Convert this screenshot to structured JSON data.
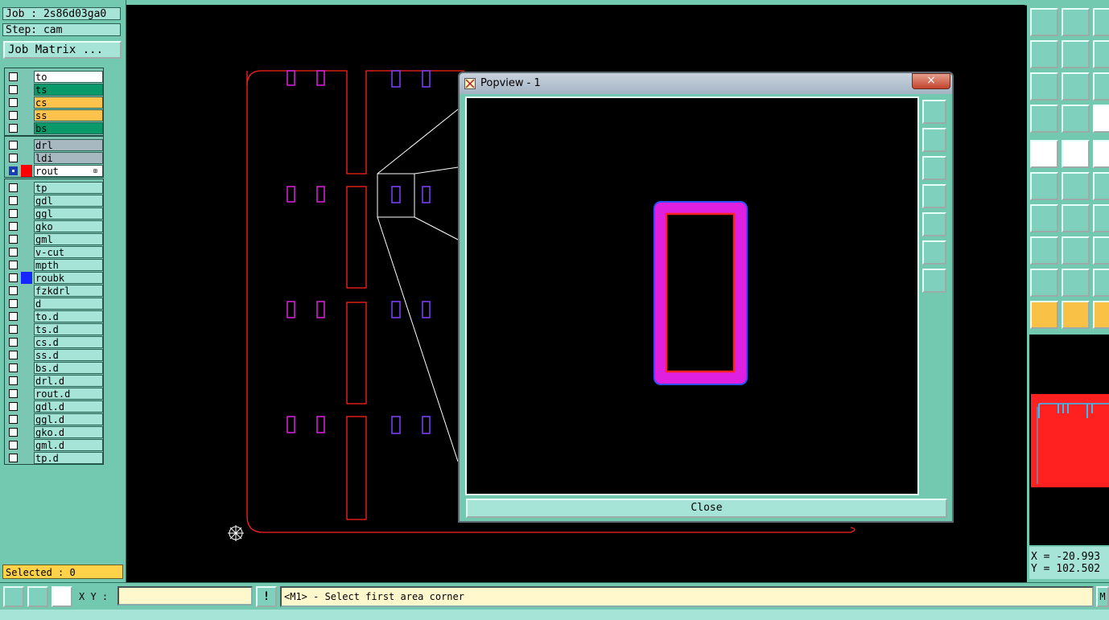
{
  "job": {
    "job_text": "Job : 2s86d03ga0",
    "step_text": "Step: cam",
    "matrix_label": "Job Matrix ..."
  },
  "layers": {
    "group1": [
      {
        "name": "to",
        "bg": "#ffffff"
      },
      {
        "name": "ts",
        "bg": "#0a9a6a"
      },
      {
        "name": "cs",
        "bg": "#ffc34d"
      },
      {
        "name": "ss",
        "bg": "#ffc34d"
      },
      {
        "name": "bs",
        "bg": "#0a9a6a"
      }
    ],
    "group2": [
      {
        "name": "drl",
        "bg": "#a8b8c0"
      },
      {
        "name": "ldi",
        "bg": "#a8b8c0"
      },
      {
        "name": "rout",
        "bg": "#ffffff",
        "swatch": "#ff0000",
        "active": true
      }
    ],
    "group3": [
      {
        "name": "tp"
      },
      {
        "name": "gdl"
      },
      {
        "name": "ggl"
      },
      {
        "name": "gko"
      },
      {
        "name": "gml"
      },
      {
        "name": "v-cut"
      },
      {
        "name": "mpth"
      },
      {
        "name": "roubk",
        "swatch": "#1428ff"
      },
      {
        "name": "fzkdrl"
      },
      {
        "name": "d"
      },
      {
        "name": "to.d"
      },
      {
        "name": "ts.d"
      },
      {
        "name": "cs.d"
      },
      {
        "name": "ss.d"
      },
      {
        "name": "bs.d"
      },
      {
        "name": "drl.d"
      },
      {
        "name": "rout.d"
      },
      {
        "name": "gdl.d"
      },
      {
        "name": "ggl.d"
      },
      {
        "name": "gko.d"
      },
      {
        "name": "gml.d"
      },
      {
        "name": "tp.d"
      }
    ]
  },
  "selected_text": "Selected : 0",
  "popview": {
    "title": "Popview - 1",
    "close_x": "×",
    "close_label": "Close"
  },
  "coords": {
    "x": "X = -20.993",
    "y": "Y = 102.502"
  },
  "bottom": {
    "xy_label": "X Y :",
    "xy_value": "",
    "alert_label": "!",
    "message": "<M1> - Select first area corner",
    "right_btn": "M"
  },
  "colors": {
    "panel": "#73c9b0",
    "board_outline": "#ff2020",
    "pad_magenta": "#e020e0",
    "pad_purple": "#8040ff",
    "accent_yellow": "#ffd24a"
  }
}
